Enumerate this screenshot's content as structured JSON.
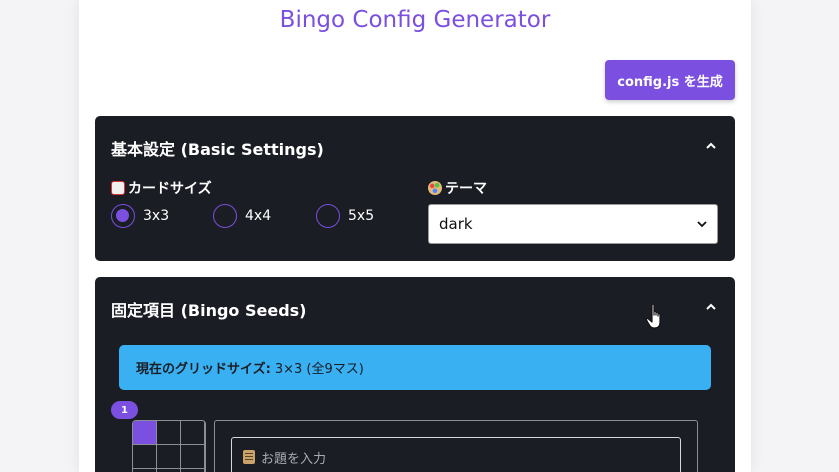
{
  "app": {
    "title": "Bingo Config Generator",
    "generate_label": "config.js を生成"
  },
  "basic_panel": {
    "title": "基本設定 (Basic Settings)",
    "card_size": {
      "label": "カードサイズ",
      "icon": "playing-card-icon",
      "options": [
        "3x3",
        "4x4",
        "5x5"
      ],
      "selected": "3x3"
    },
    "theme": {
      "label": "テーマ",
      "icon": "palette-icon",
      "value": "dark"
    }
  },
  "seeds_panel": {
    "title": "固定項目 (Bingo Seeds)",
    "grid_info_label": "現在のグリッドサイズ:",
    "grid_info_value": "3×3 (全9マス)",
    "item_badge": "1",
    "input_placeholder": "お題を入力",
    "input_icon": "memo-icon"
  },
  "colors": {
    "accent": "#7b4fe0",
    "panel_bg": "#1b1d24",
    "info": "#38b0f2"
  }
}
